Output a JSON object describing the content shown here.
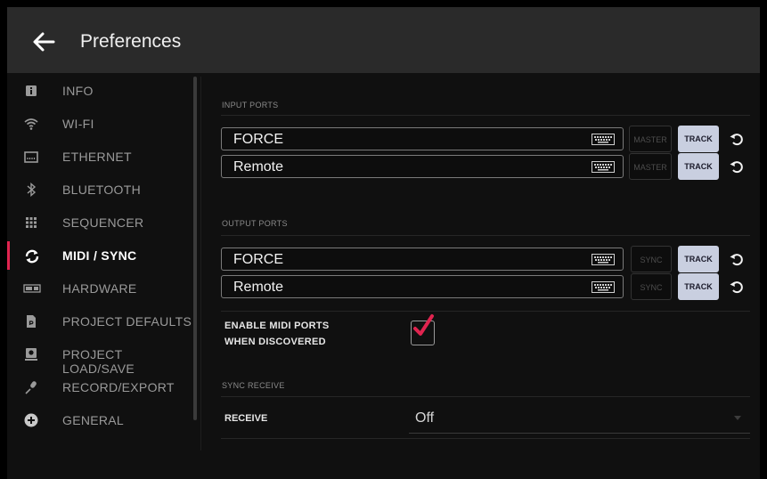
{
  "header": {
    "title": "Preferences"
  },
  "sidebar": {
    "items": [
      {
        "label": "INFO",
        "icon": "info-icon"
      },
      {
        "label": "WI-FI",
        "icon": "wifi-icon"
      },
      {
        "label": "ETHERNET",
        "icon": "ethernet-icon"
      },
      {
        "label": "BLUETOOTH",
        "icon": "bluetooth-icon"
      },
      {
        "label": "SEQUENCER",
        "icon": "sequencer-icon"
      },
      {
        "label": "MIDI / SYNC",
        "icon": "midi-sync-icon",
        "active": true
      },
      {
        "label": "HARDWARE",
        "icon": "hardware-icon"
      },
      {
        "label": "PROJECT DEFAULTS",
        "icon": "project-defaults-icon"
      },
      {
        "label": "PROJECT LOAD/SAVE",
        "icon": "project-load-save-icon"
      },
      {
        "label": "RECORD/EXPORT",
        "icon": "microphone-icon"
      },
      {
        "label": "GENERAL",
        "icon": "plus-circle-icon"
      }
    ]
  },
  "input_ports": {
    "section_label": "INPUT PORTS",
    "ports": [
      {
        "name": "FORCE",
        "mode_label": "MASTER",
        "track_label": "TRACK"
      },
      {
        "name": "Remote",
        "mode_label": "MASTER",
        "track_label": "TRACK"
      }
    ]
  },
  "output_ports": {
    "section_label": "OUTPUT PORTS",
    "ports": [
      {
        "name": "FORCE",
        "mode_label": "SYNC",
        "track_label": "TRACK"
      },
      {
        "name": "Remote",
        "mode_label": "SYNC",
        "track_label": "TRACK"
      }
    ]
  },
  "enable_midi": {
    "label_line1": "ENABLE MIDI PORTS",
    "label_line2": "WHEN DISCOVERED",
    "checked": true
  },
  "sync_receive": {
    "section_label": "SYNC RECEIVE",
    "receive_label": "RECEIVE",
    "receive_value": "Off"
  },
  "colors": {
    "accent": "#e0244f",
    "header_bg": "#2a2a2a",
    "toggle_on": "#c9cfe0"
  }
}
